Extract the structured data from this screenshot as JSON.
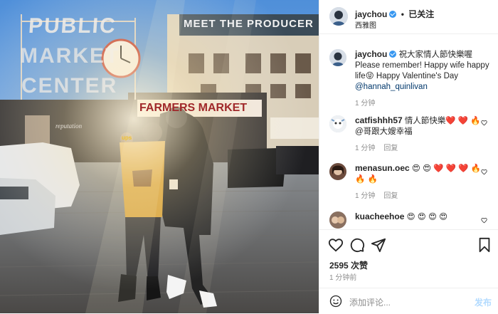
{
  "post": {
    "username": "jaychou",
    "follow_status": "已关注",
    "location": "西雅图",
    "caption_prefix": "祝大家情人節快樂喔 Please remember! Happy wife happy life😝 Happy Valentine's Day",
    "caption_mention": "@hannah_quinlivan",
    "caption_time": "1 分钟"
  },
  "photo": {
    "sign_public": "PUBLIC",
    "sign_market": "MARKET",
    "sign_center": "CENTER",
    "sign_producer": "MEET THE PRODUCER",
    "sign_farmers": "FARMERS MARKET",
    "poster_text": "reputation",
    "ups": "ups"
  },
  "comments": [
    {
      "username": "catfishhh57",
      "text": "情人節快樂❤️ ❤️ 🔥 @哥跟大嫂幸福",
      "time": "1 分钟",
      "reply": "回复"
    },
    {
      "username": "menasun.oec",
      "text": "😍 😍 ❤️ ❤️ ❤️ 🔥 🔥 🔥",
      "time": "1 分钟",
      "reply": "回复"
    },
    {
      "username": "kuacheehoe",
      "text": "😍 😍 😍 😍",
      "time": "",
      "reply": ""
    }
  ],
  "actions": {
    "likes": "2595 次赞",
    "time": "1 分钟前"
  },
  "add_comment": {
    "placeholder": "添加评论...",
    "post_label": "发布"
  },
  "icons": [
    "verified-badge-icon",
    "heart-icon",
    "comment-icon",
    "share-icon",
    "bookmark-icon",
    "emoji-icon"
  ],
  "colors": {
    "accent": "#3897f0",
    "link": "#00376b",
    "muted": "#8e8e8e",
    "post_disabled": "#b3dbff"
  }
}
